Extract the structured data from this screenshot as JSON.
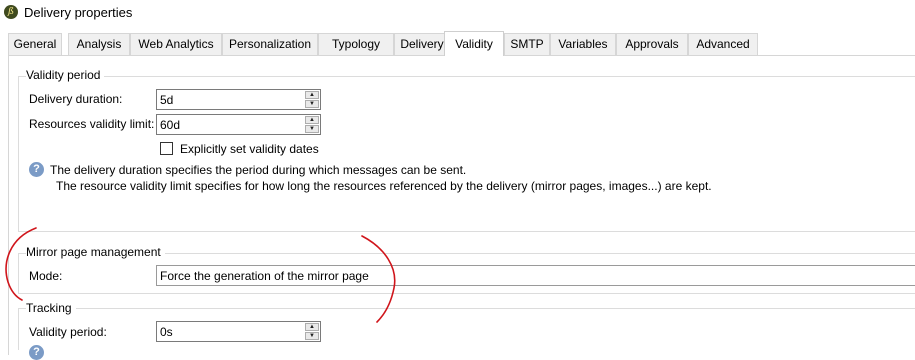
{
  "window": {
    "title": "Delivery properties",
    "icon": "app-logo-icon"
  },
  "tabs": [
    {
      "label": "General"
    },
    {
      "label": "Analysis"
    },
    {
      "label": "Web Analytics"
    },
    {
      "label": "Personalization"
    },
    {
      "label": "Typology"
    },
    {
      "label": "Delivery"
    },
    {
      "label": "Validity",
      "active": true
    },
    {
      "label": "SMTP"
    },
    {
      "label": "Variables"
    },
    {
      "label": "Approvals"
    },
    {
      "label": "Advanced"
    }
  ],
  "validity_period": {
    "group_label": "Validity period",
    "delivery_duration_label": "Delivery duration:",
    "delivery_duration_value": "5d",
    "resources_validity_label": "Resources validity limit:",
    "resources_validity_value": "60d",
    "explicit_dates_label": "Explicitly set validity dates",
    "explicit_dates_checked": false,
    "info_line1": "The delivery duration specifies the period during which messages can be sent.",
    "info_line2": "The resource validity limit specifies for how long the resources referenced by the delivery (mirror pages, images...) are kept."
  },
  "mirror_page": {
    "group_label": "Mirror page management",
    "mode_label": "Mode:",
    "mode_value": "Force the generation of the mirror page"
  },
  "tracking": {
    "group_label": "Tracking",
    "validity_period_label": "Validity period:",
    "validity_period_value": "0s"
  },
  "colors": {
    "annotation": "#d0151b",
    "info_icon": "#7b9bc6"
  }
}
